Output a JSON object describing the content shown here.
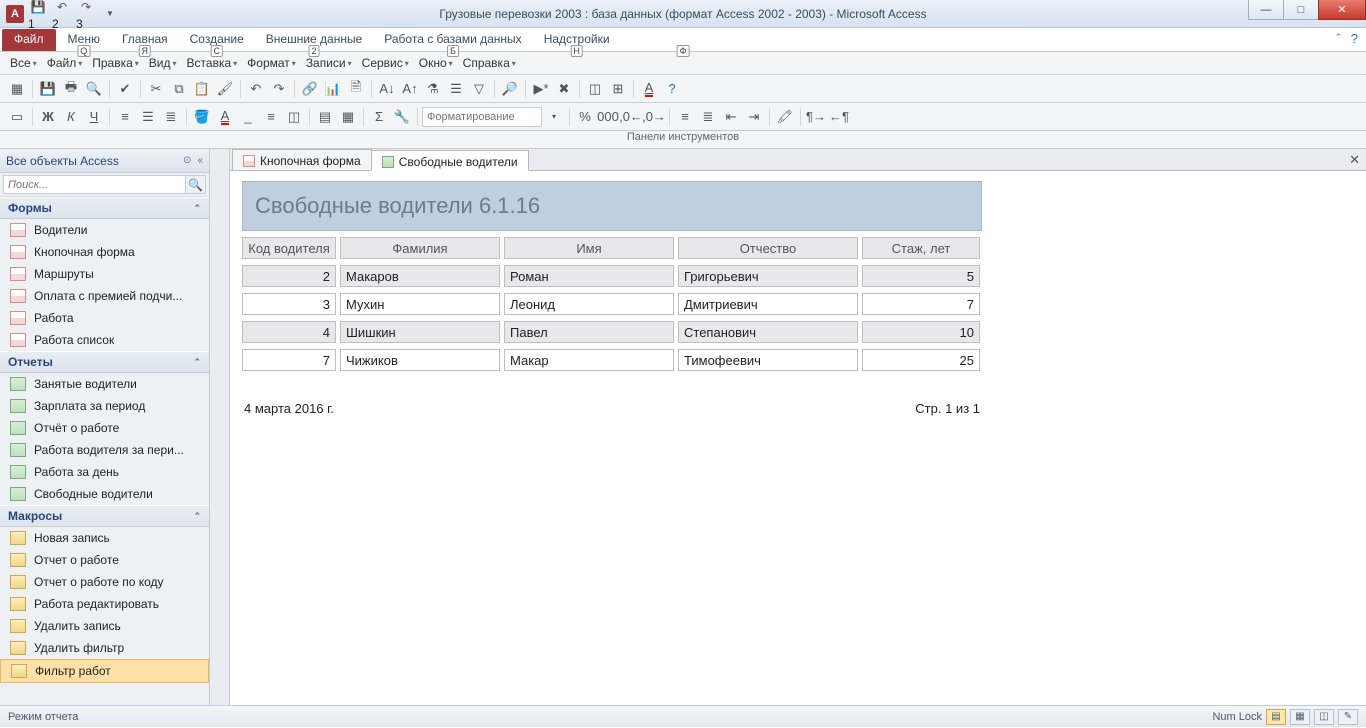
{
  "title": "Грузовые перевозки 2003 : база данных (формат Access 2002 - 2003)  -  Microsoft Access",
  "ribbon": {
    "file": "Файл",
    "tabs": [
      "Меню",
      "Главная",
      "Создание",
      "Внешние данные",
      "Работа с базами данных",
      "Надстройки"
    ],
    "help_chevron": "˄"
  },
  "menubar": {
    "items": [
      "Все",
      "Файл",
      "Правка",
      "Вид",
      "Вставка",
      "Формат",
      "Записи",
      "Сервис",
      "Окно",
      "Справка"
    ]
  },
  "keytips": {
    "qat": [
      "1",
      "2",
      "3"
    ],
    "tabs": [
      "Ф",
      "Q",
      "Я",
      "С",
      "2",
      "Б",
      "Н"
    ]
  },
  "format_placeholder": "Форматирование",
  "toolbarsLabel": "Панели инструментов",
  "nav": {
    "header": "Все объекты Access",
    "searchPlaceholder": "Поиск...",
    "groups": [
      {
        "title": "Формы",
        "type": "form",
        "items": [
          "Водители",
          "Кнопочная форма",
          "Маршруты",
          "Оплата с премией подчи...",
          "Работа",
          "Работа список"
        ]
      },
      {
        "title": "Отчеты",
        "type": "report",
        "items": [
          "Занятые водители",
          "Зарплата за период",
          "Отчёт о работе",
          "Работа водителя за пери...",
          "Работа за день",
          "Свободные водители"
        ]
      },
      {
        "title": "Макросы",
        "type": "macro",
        "items": [
          "Новая запись",
          "Отчет о работе",
          "Отчет о работе по коду",
          "Работа редактировать",
          "Удалить запись",
          "Удалить фильтр",
          "Фильтр работ"
        ]
      }
    ]
  },
  "doctabs": [
    {
      "label": "Кнопочная форма",
      "iconClass": "ic-form",
      "active": false
    },
    {
      "label": "Свободные водители",
      "iconClass": "ic-report",
      "active": true
    }
  ],
  "report": {
    "title": "Свободные водители   6.1.16",
    "columns": [
      "Код водителя",
      "Фамилия",
      "Имя",
      "Отчество",
      "Стаж, лет"
    ],
    "rows": [
      {
        "id": "2",
        "fam": "Макаров",
        "name": "Роман",
        "otch": "Григорьевич",
        "exp": "5"
      },
      {
        "id": "3",
        "fam": "Мухин",
        "name": "Леонид",
        "otch": "Дмитриевич",
        "exp": "7"
      },
      {
        "id": "4",
        "fam": "Шишкин",
        "name": "Павел",
        "otch": "Степанович",
        "exp": "10"
      },
      {
        "id": "7",
        "fam": "Чижиков",
        "name": "Макар",
        "otch": "Тимофеевич",
        "exp": "25"
      }
    ],
    "date": "4 марта 2016 г.",
    "page": "Стр. 1 из 1"
  },
  "status": {
    "left": "Режим отчета",
    "numlock": "Num Lock"
  }
}
